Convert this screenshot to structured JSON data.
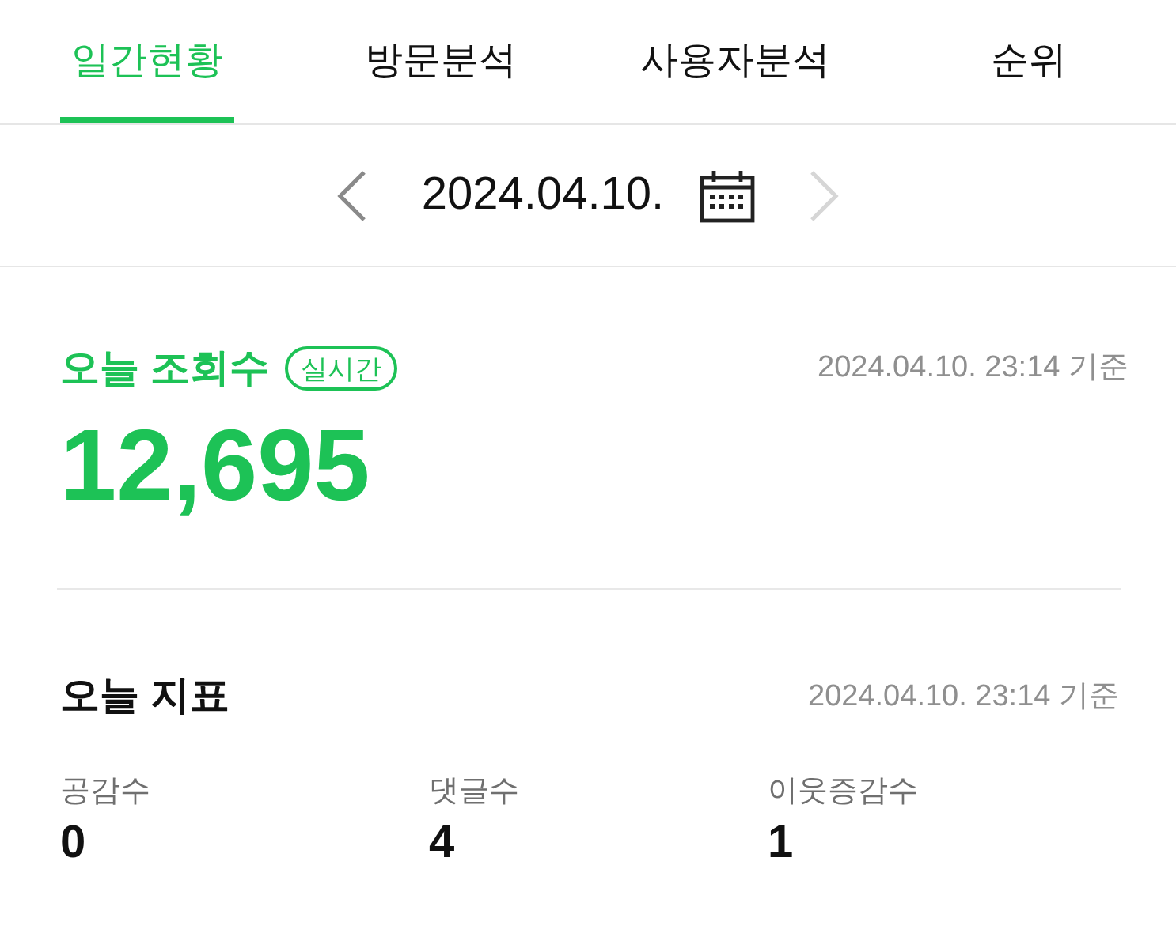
{
  "tabs": [
    {
      "label": "일간현황",
      "selected": true
    },
    {
      "label": "방문분석",
      "selected": false
    },
    {
      "label": "사용자분석",
      "selected": false
    },
    {
      "label": "순위",
      "selected": false
    }
  ],
  "date_nav": {
    "prev": {
      "disabled": false
    },
    "date": "2024.04.10.",
    "next": {
      "disabled": true
    }
  },
  "views": {
    "title": "오늘 조회수",
    "badge": "실시간",
    "timestamp": "2024.04.10. 23:14 기준",
    "value": "12,695"
  },
  "indicators": {
    "title": "오늘 지표",
    "timestamp": "2024.04.10. 23:14 기준",
    "metrics": [
      {
        "label": "공감수",
        "value": "0"
      },
      {
        "label": "댓글수",
        "value": "4"
      },
      {
        "label": "이웃증감수",
        "value": "1"
      }
    ]
  }
}
